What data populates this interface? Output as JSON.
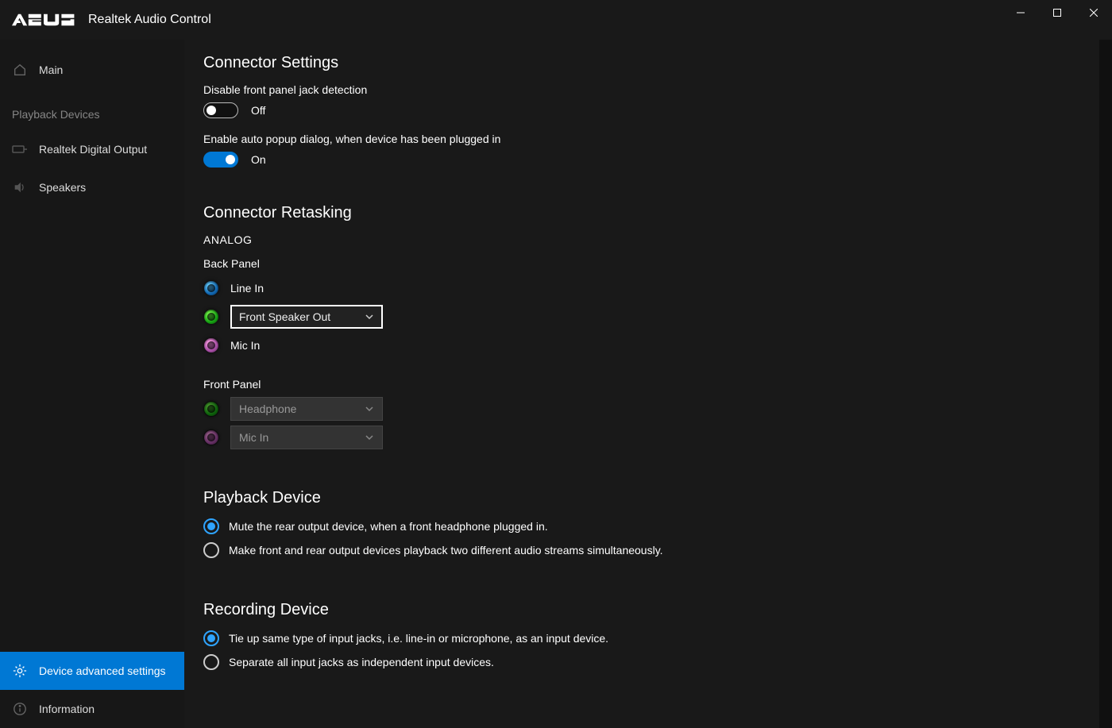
{
  "titlebar": {
    "logo_text": "ASUS",
    "app_title": "Realtek Audio Control"
  },
  "sidebar": {
    "main_label": "Main",
    "playback_heading": "Playback Devices",
    "item_digital": "Realtek Digital Output",
    "item_speakers": "Speakers",
    "item_advanced": "Device advanced settings",
    "item_info": "Information"
  },
  "connector_settings": {
    "title": "Connector Settings",
    "front_jack_label": "Disable front panel jack detection",
    "front_jack_state": "Off",
    "popup_label": "Enable auto popup dialog, when device has been plugged in",
    "popup_state": "On"
  },
  "retasking": {
    "title": "Connector Retasking",
    "analog_label": "ANALOG",
    "back_panel_label": "Back Panel",
    "line_in": "Line In",
    "front_speaker_selected": "Front Speaker Out",
    "mic_in": "Mic In",
    "front_panel_label": "Front Panel",
    "headphone_selected": "Headphone",
    "fp_mic_selected": "Mic In"
  },
  "playback_device": {
    "title": "Playback Device",
    "opt1": "Mute the rear output device, when a front headphone plugged in.",
    "opt2": "Make front and rear output devices playback two different audio streams simultaneously."
  },
  "recording_device": {
    "title": "Recording Device",
    "opt1": "Tie up same type of input jacks, i.e. line-in or microphone, as an input device.",
    "opt2": "Separate all input jacks as independent input devices."
  }
}
